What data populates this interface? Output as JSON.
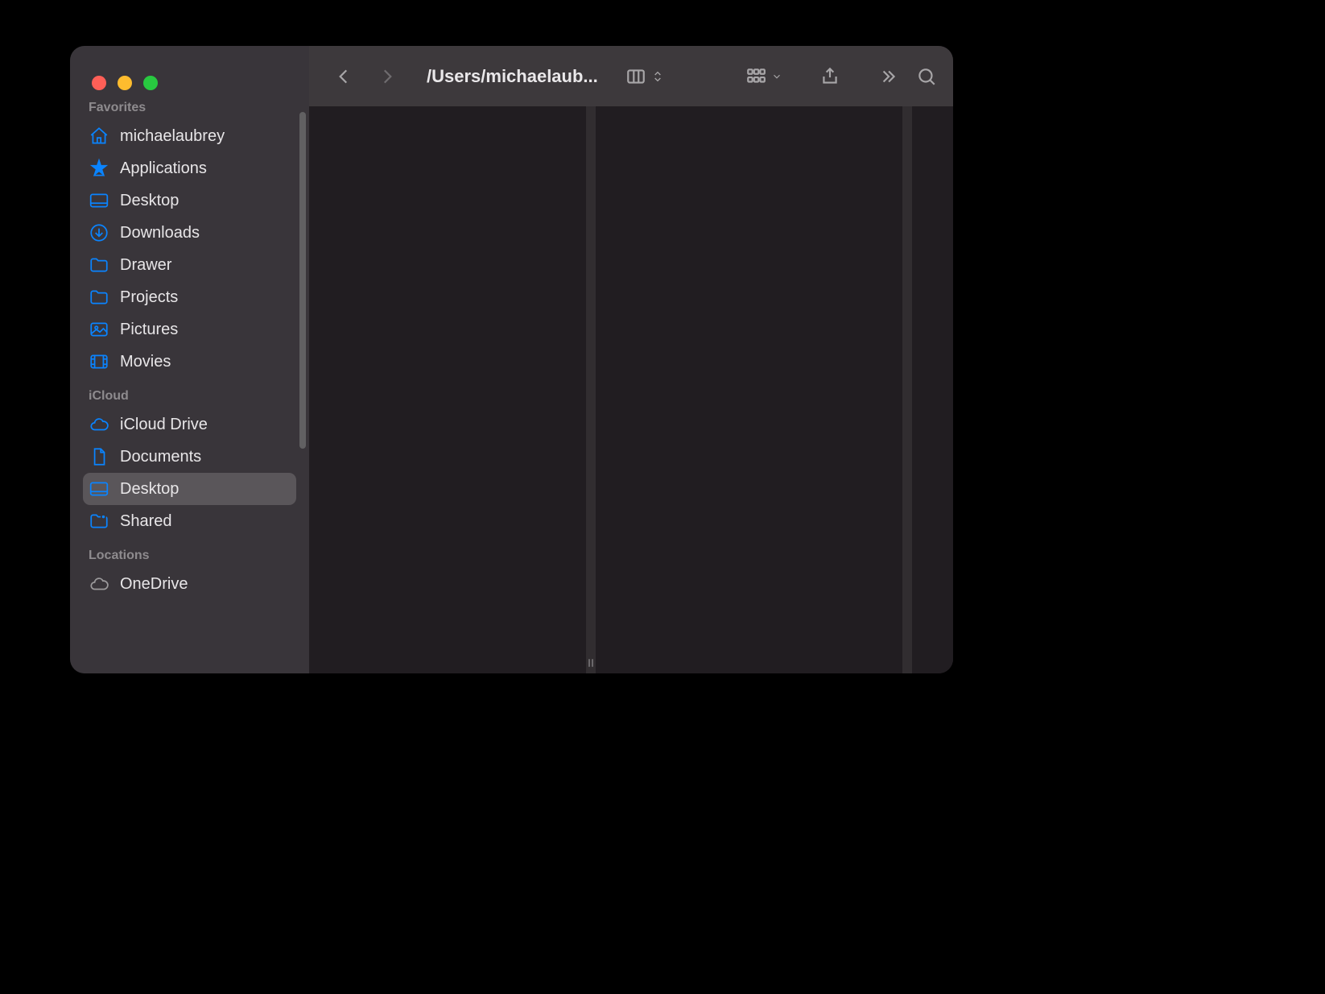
{
  "toolbar": {
    "path_title": "/Users/michaelaub..."
  },
  "sidebar": {
    "sections": [
      {
        "heading": "Favorites",
        "items": [
          {
            "label": "michaelaubrey",
            "icon": "home"
          },
          {
            "label": "Applications",
            "icon": "apps"
          },
          {
            "label": "Desktop",
            "icon": "desktop"
          },
          {
            "label": "Downloads",
            "icon": "downloads"
          },
          {
            "label": "Drawer",
            "icon": "folder"
          },
          {
            "label": "Projects",
            "icon": "folder"
          },
          {
            "label": "Pictures",
            "icon": "pictures"
          },
          {
            "label": "Movies",
            "icon": "movies"
          }
        ]
      },
      {
        "heading": "iCloud",
        "items": [
          {
            "label": "iCloud Drive",
            "icon": "cloud"
          },
          {
            "label": "Documents",
            "icon": "document"
          },
          {
            "label": "Desktop",
            "icon": "desktop",
            "selected": true
          },
          {
            "label": "Shared",
            "icon": "shared"
          }
        ]
      },
      {
        "heading": "Locations",
        "items": [
          {
            "label": "OneDrive",
            "icon": "cloud-gray"
          }
        ]
      }
    ]
  }
}
